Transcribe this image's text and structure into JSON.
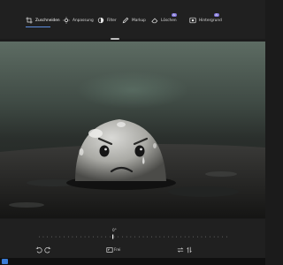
{
  "toolbar": {
    "tools": [
      {
        "label": "Zuschneiden",
        "icon": "crop-icon"
      },
      {
        "label": "Anpassung",
        "icon": "adjust-icon"
      },
      {
        "label": "Filter",
        "icon": "filter-icon"
      },
      {
        "label": "Markup",
        "icon": "markup-icon"
      },
      {
        "label": "Löschen",
        "icon": "erase-icon",
        "badge": "AI"
      },
      {
        "label": "Hintergrund",
        "icon": "background-icon",
        "badge": "AI"
      }
    ],
    "active_tool": "Zuschneiden",
    "accent_color": "#5e8ee0",
    "badge_color": "#7a6fd6"
  },
  "image": {
    "subject": "sad droplet face on wet dark surface"
  },
  "bottom": {
    "angle": "0°",
    "fit_label": "Frei",
    "buttons": [
      "rotate-left-icon",
      "rotate-right-icon",
      "aspect-ratio-icon",
      "flip-horizontal-icon",
      "flip-vertical-icon"
    ]
  }
}
